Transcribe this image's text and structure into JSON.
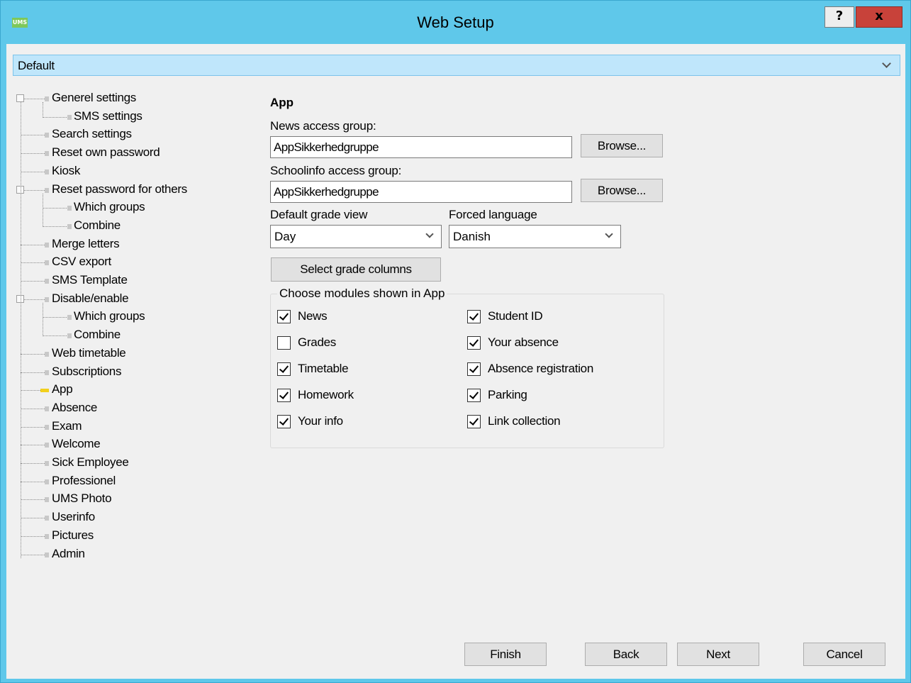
{
  "window": {
    "title": "Web Setup",
    "app_icon_text": "UMS",
    "help_label": "?",
    "close_label": "x"
  },
  "profile": {
    "selected": "Default"
  },
  "tree": {
    "items": [
      {
        "label": "Generel settings",
        "level": 0,
        "expander": true
      },
      {
        "label": "SMS settings",
        "level": 1
      },
      {
        "label": "Search settings",
        "level": 0
      },
      {
        "label": "Reset own password",
        "level": 0
      },
      {
        "label": "Kiosk",
        "level": 0
      },
      {
        "label": "Reset password for others",
        "level": 0,
        "expander": true
      },
      {
        "label": "Which groups",
        "level": 1
      },
      {
        "label": "Combine",
        "level": 1
      },
      {
        "label": "Merge letters",
        "level": 0
      },
      {
        "label": "CSV export",
        "level": 0
      },
      {
        "label": "SMS Template",
        "level": 0
      },
      {
        "label": "Disable/enable",
        "level": 0,
        "expander": true
      },
      {
        "label": "Which groups",
        "level": 1
      },
      {
        "label": "Combine",
        "level": 1
      },
      {
        "label": "Web timetable",
        "level": 0
      },
      {
        "label": "Subscriptions",
        "level": 0
      },
      {
        "label": "App",
        "level": 0,
        "selected": true
      },
      {
        "label": "Absence",
        "level": 0
      },
      {
        "label": "Exam",
        "level": 0
      },
      {
        "label": "Welcome",
        "level": 0
      },
      {
        "label": "Sick Employee",
        "level": 0
      },
      {
        "label": "Professionel",
        "level": 0
      },
      {
        "label": "UMS Photo",
        "level": 0
      },
      {
        "label": "Userinfo",
        "level": 0
      },
      {
        "label": "Pictures",
        "level": 0
      },
      {
        "label": "Admin",
        "level": 0
      }
    ]
  },
  "panel": {
    "section_title": "App",
    "news_label": "News access group:",
    "news_value": "AppSikkerhedgruppe",
    "schoolinfo_label": "Schoolinfo access group:",
    "schoolinfo_value": "AppSikkerhedgruppe",
    "browse_label": "Browse...",
    "grade_view_label": "Default grade view",
    "grade_view_value": "Day",
    "language_label": "Forced language",
    "language_value": "Danish",
    "select_columns_label": "Select grade columns",
    "modules_legend": "Choose modules shown in App",
    "modules_left": [
      {
        "label": "News",
        "checked": true
      },
      {
        "label": "Grades",
        "checked": false
      },
      {
        "label": "Timetable",
        "checked": true
      },
      {
        "label": "Homework",
        "checked": true
      },
      {
        "label": "Your info",
        "checked": true
      }
    ],
    "modules_right": [
      {
        "label": "Student ID",
        "checked": true
      },
      {
        "label": "Your absence",
        "checked": true
      },
      {
        "label": "Absence registration",
        "checked": true
      },
      {
        "label": "Parking",
        "checked": true
      },
      {
        "label": "Link collection",
        "checked": true
      }
    ]
  },
  "footer": {
    "finish": "Finish",
    "back": "Back",
    "next": "Next",
    "cancel": "Cancel"
  },
  "colors": {
    "titlebar": "#5fc8ea",
    "close": "#c8423a",
    "selection": "#f2d01c",
    "dropdown_bg": "#bfe6fb"
  }
}
